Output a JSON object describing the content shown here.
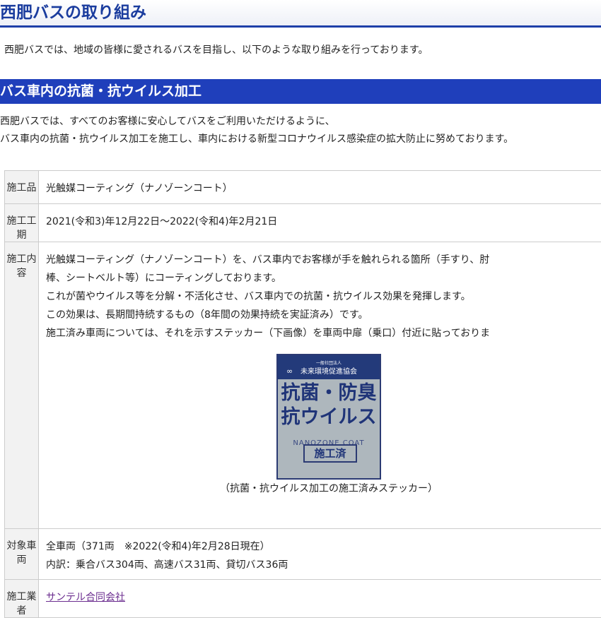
{
  "page": {
    "title": "西肥バスの取り組み",
    "intro": "西肥バスでは、地域の皆様に愛されるバスを目指し、以下のような取り組みを行っております。"
  },
  "section": {
    "heading": "バス車内の抗菌・抗ウイルス加工",
    "desc_line1": "西肥バスでは、すべてのお客様に安心してバスをご利用いただけるように、",
    "desc_line2": "バス車内の抗菌・抗ウイルス加工を施工し、車内における新型コロナウイルス感染症の拡大防止に努めております。"
  },
  "table": {
    "rows": [
      {
        "label": "施工品",
        "value": "光触媒コーティング（ナノゾーンコート）"
      },
      {
        "label": "施工工期",
        "value": "2021(令和3)年12月22日～2022(令和4)年2月21日"
      },
      {
        "label": "施工内容",
        "lines": [
          "光触媒コーティング（ナノゾーンコート）を、バス車内でお客様が手を触れられる箇所（手すり、肘",
          "棒、シートベルト等）にコーティングしております。",
          "これが菌やウイルス等を分解・不活化させ、バス車内での抗菌・抗ウイルス効果を発揮します。",
          "この効果は、長期間持続するもの（8年間の効果持続を実証済み）です。",
          "施工済み車両については、それを示すステッカー（下画像）を車両中扉（乗口）付近に貼っておりま"
        ]
      },
      {
        "label": "対象車両",
        "lines": [
          "全車両（371両　※2022(令和4)年2月28日現在）",
          "内訳：乗合バス304両、高速バス31両、貸切バス36両"
        ]
      },
      {
        "label": "施工業者",
        "value": "サンテル合同会社"
      }
    ]
  },
  "sticker": {
    "org_top": "一般社団法人",
    "org": "未来環境促進協会",
    "line1": "抗菌・防臭",
    "line2": "抗ウイルス",
    "brand": "NANOZONE COAT",
    "badge": "施工済",
    "caption": "（抗菌・抗ウイルス加工の施工済みステッカー）",
    "colors": {
      "background": "#aeb7bd",
      "band": "#233a7a",
      "text": "#1f3478"
    }
  }
}
